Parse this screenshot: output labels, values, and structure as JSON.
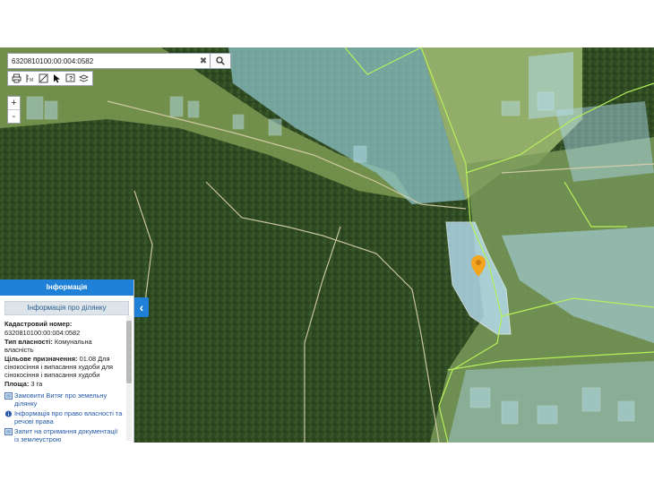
{
  "search": {
    "value": "6320810100:00:004:0582",
    "clear_label": "✖"
  },
  "toolbar": {
    "tools": [
      "print-icon",
      "ruler-icon",
      "measure-area-icon",
      "cursor-icon",
      "info-icon",
      "layers-icon"
    ]
  },
  "zoom": {
    "in_label": "+",
    "out_label": "-"
  },
  "info": {
    "header": "Інформація",
    "subheader": "Інформація про ділянку",
    "cadastral_label": "Кадастровий номер:",
    "cadastral_value": "6320810100:00:004:0582",
    "ownership_label": "Тип власності:",
    "ownership_value": "Комунальна власність",
    "purpose_label": "Цільове призначення:",
    "purpose_value": "01.08 Для сінокосіння і випасання худоби для сінокосіння і випасання худоби",
    "area_label": "Площа:",
    "area_value": "3 га",
    "links": [
      "Замовити Витяг про земельну ділянку",
      "Інформація про право власності та речові права",
      "Запит на отримання документації із землеустрою"
    ]
  },
  "collapse_label": "‹",
  "colors": {
    "accent": "#1f80d8",
    "marker": "#f3a51d",
    "parcel_fill": "#9fd0ef",
    "boundary_green": "#b6f05a"
  }
}
